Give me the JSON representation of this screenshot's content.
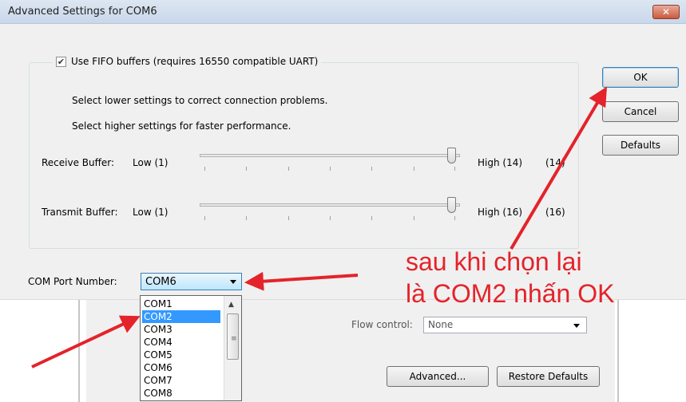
{
  "dialog": {
    "title": "Advanced Settings for COM6",
    "close_label": "✕",
    "fifo": {
      "checked": true,
      "check_glyph": "✔",
      "label": "Use FIFO buffers (requires 16550 compatible UART)"
    },
    "hint_lower": "Select lower settings to correct connection problems.",
    "hint_higher": "Select higher settings for faster performance.",
    "receive_buffer": {
      "label": "Receive Buffer:",
      "low_label": "Low (1)",
      "high_label": "High (14)",
      "value": "(14)",
      "level": 1.0
    },
    "transmit_buffer": {
      "label": "Transmit Buffer:",
      "low_label": "Low (1)",
      "high_label": "High (16)",
      "value": "(16)",
      "level": 1.0
    },
    "buttons": {
      "ok": "OK",
      "cancel": "Cancel",
      "defaults": "Defaults"
    },
    "com_port": {
      "label": "COM Port Number:",
      "selected": "COM6",
      "options": [
        "COM1",
        "COM2",
        "COM3",
        "COM4",
        "COM5",
        "COM6",
        "COM7",
        "COM8"
      ],
      "highlighted": "COM2"
    }
  },
  "parent_window": {
    "flow_control_label": "Flow control:",
    "flow_control_value": "None",
    "advanced_button": "Advanced...",
    "restore_defaults_button": "Restore Defaults"
  },
  "annotation": {
    "line1": "sau khi chọn lại",
    "line2": "là COM2 nhấn OK",
    "color": "#e4232a"
  },
  "icons": {
    "close": "close-icon",
    "dropdown_arrow": "chevron-down-icon",
    "scroll_up": "scroll-up-icon"
  }
}
